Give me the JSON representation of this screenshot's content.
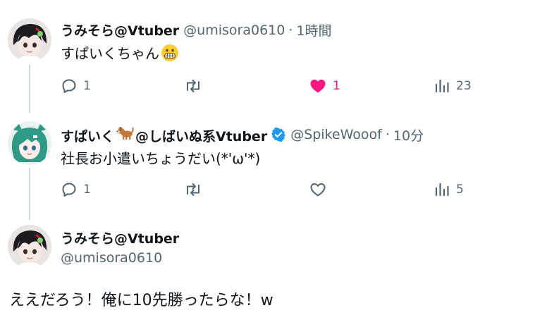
{
  "tweets": [
    {
      "name": "うみそら@Vtuber",
      "handle": "@umisora0610",
      "time": "1時間",
      "text": "すぱいくちゃん",
      "emoji": "grimacing-face-emoji",
      "actions": {
        "replies": "1",
        "retweets": "",
        "likes": "1",
        "views": "23",
        "liked": true
      }
    },
    {
      "name_prefix": "すぱいく",
      "name_suffix": "@しばいぬ系Vtuber",
      "name_emoji": "dog-emoji",
      "verified": true,
      "handle": "@SpikeWooof",
      "time": "10分",
      "text": "社長お小遣いちょうだい(*'ω'*)",
      "actions": {
        "replies": "1",
        "retweets": "",
        "likes": "",
        "views": "5",
        "liked": false
      }
    }
  ],
  "focused": {
    "name": "うみそら@Vtuber",
    "handle": "@umisora0610",
    "text": "ええだろう！俺に10先勝ったらな！w"
  },
  "sep": "·",
  "colors": {
    "accent_like": "#f91880",
    "verified": "#1d9bf0",
    "muted": "#536471",
    "thread_line": "#cfd9de"
  }
}
